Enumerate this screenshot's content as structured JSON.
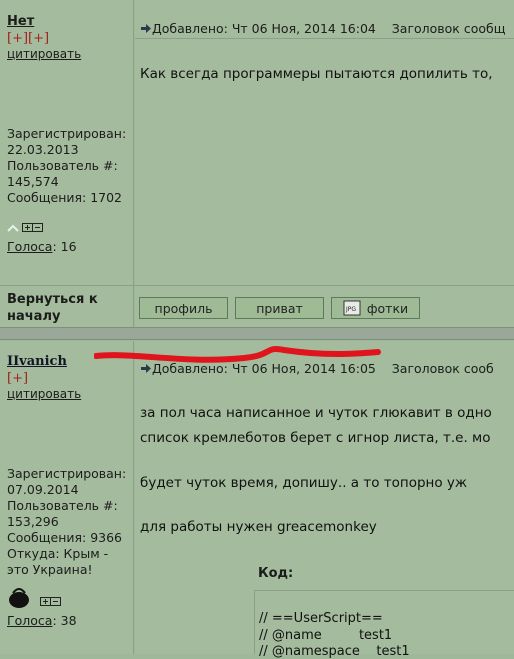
{
  "post1": {
    "username": "Нет",
    "rating": "[+][+]",
    "quote": "цитировать",
    "registered_label": "Зарегистрирован:",
    "registered_date": "22.03.2013",
    "user_id_label": "Пользователь #:",
    "user_id": "145,574",
    "messages": "Сообщения: 1702",
    "votes_label": "Голоса",
    "votes_count": ": 16",
    "added": "Добавлено: Чт 06 Ноя, 2014 16:04",
    "subject": "Заголовок сообщ",
    "text": "Как всегда программеры пытаются допилить то,"
  },
  "back_to_top": "Вернуться к началу",
  "buttons": {
    "profile": "профиль",
    "private": "приват",
    "photos": "фотки"
  },
  "post2": {
    "username": "IIvanich",
    "rating": "[+]",
    "quote": "цитировать",
    "registered_label": "Зарегистрирован:",
    "registered_date": "07.09.2014",
    "user_id_label": "Пользователь #:",
    "user_id": "153,296",
    "messages": "Сообщения: 9366",
    "from": "Откуда: Крым - это Украина!",
    "votes_label": "Голоса",
    "votes_count": ": 38",
    "added": "Добавлено: Чт 06 Ноя, 2014 16:05",
    "subject": "Заголовок сооб",
    "lines": [
      "за пол часа написанное и чуток глюкавит в одно",
      "список кремлеботов берет с игнор листа, т.е. мо",
      "будет чуток время, допишу.. а то топорно уж",
      "для работы нужен greacemonkey"
    ],
    "code_label": "Код:",
    "code_lines": [
      "// ==UserScript==",
      "// @name         test1",
      "// @namespace    test1"
    ]
  },
  "colors": {
    "background": "#a4bc9d",
    "accent_red": "#e0141c",
    "rating_red": "#a0201c"
  },
  "icons": [
    "reply-arrow-icon",
    "plus-box-icon",
    "minus-box-icon",
    "online-icon",
    "user-avatar-icon",
    "photo-icon"
  ]
}
